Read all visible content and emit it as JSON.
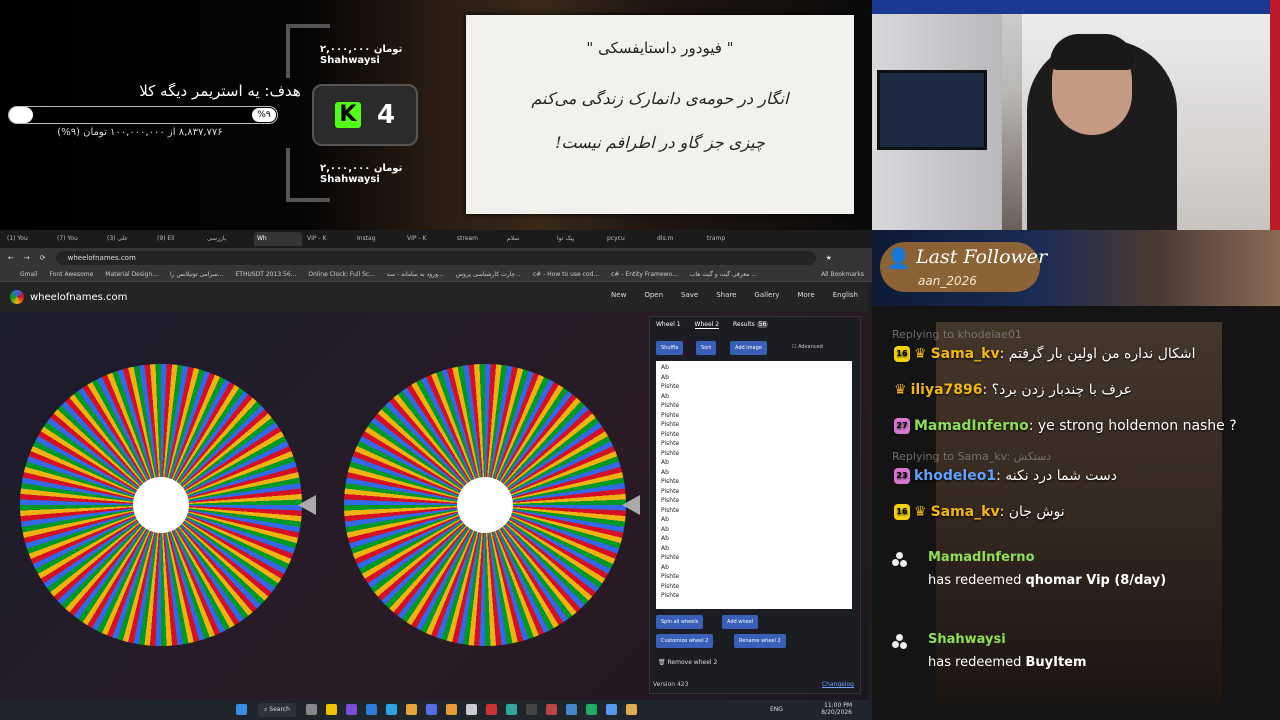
{
  "overlay": {
    "goal_title": "هدف: یه استریمر دیگه کلا",
    "goal_percent": "%۹",
    "goal_progress": 0.09,
    "goal_amount": "۸,۸۳۷,۷۷۶ از ۱۰۰,۰۰۰,۰۰۰ تومان (۹%)",
    "donation_top": {
      "user": "Shahwaysi",
      "amount": "۲,۰۰۰,۰۰۰ تومان"
    },
    "donation_bottom": {
      "user": "Shahwaysi",
      "amount": "۲,۰۰۰,۰۰۰ تومان"
    },
    "kick_logo": "K",
    "kick_count": "4",
    "quote": {
      "title": "\" فیودور داستایفسکی \"",
      "line1": "انگار در حومه‌ی دانمارک زندگی می‌کنم",
      "line2": "چیزی جز گاو در اطرافم نیست!"
    }
  },
  "browser": {
    "tabs": [
      "(1) You",
      "(7) You",
      "(3) علی",
      "(9) Eli",
      "بازرسی",
      "Wh",
      "VIP - K",
      "Instag",
      "VIP - K",
      "stream",
      "سلام",
      "پیک توا",
      "pcycu",
      "dls.m",
      "tramp"
    ],
    "active_tab_index": 5,
    "url": "wheelofnames.com",
    "bookmarks": [
      "Gmail",
      "Font Awesome",
      "Material Design...",
      "سرامی توتیلانس را...",
      "ETHUSDT 2013.56...",
      "Online Clock: Full Sc...",
      "ورود به سامانه - سه...",
      "چارت کارشناسی پروس...",
      "c# - How to use cod...",
      "c# - Entity Framewo...",
      "معرفی گیت و گیت هاب ..."
    ],
    "all_bookmarks": "All Bookmarks",
    "site_name": "wheelofnames.com",
    "site_menu": [
      "New",
      "Open",
      "Save",
      "Share",
      "Gallery",
      "More",
      "English"
    ],
    "panel": {
      "tab_wheel1": "Wheel 1",
      "tab_wheel2": "Wheel 2",
      "tab_results": "Results",
      "results_count": "56",
      "shuffle": "Shuffle",
      "sort": "Sort",
      "add_image": "Add image",
      "advanced": "Advanced",
      "entries": [
        "Ab",
        "Ab",
        "Pishte",
        "Ab",
        "Pishte",
        "Pishte",
        "Pishte",
        "Pishte",
        "Pishte",
        "Pishte",
        "Ab",
        "Ab",
        "Pishte",
        "Pishte",
        "Pishte",
        "Pishte",
        "Ab",
        "Ab",
        "Ab",
        "Ab",
        "Pishte",
        "Ab",
        "Pishte",
        "Pishte",
        "Pishte"
      ],
      "spin_all": "Spin all wheels",
      "add_wheel": "Add wheel",
      "customize": "Customize wheel 2",
      "rename": "Rename wheel 2",
      "remove": "Remove wheel 2",
      "version": "Version 423",
      "changelog": "Changelog"
    },
    "wheel_segments": 160,
    "wheel_colors": [
      "#3369e8",
      "#d50f25",
      "#eeb211",
      "#009925"
    ]
  },
  "taskbar": {
    "search": "Search",
    "lang": "ENG",
    "time": "11:00 PM",
    "date": "8/20/2026"
  },
  "follower": {
    "label": "Last Follower",
    "name": "aan_2026"
  },
  "chat": {
    "reply1": "Replying to khodelae01",
    "messages": [
      {
        "badge": "16",
        "user": "Sama_kv",
        "color": "#f3b712",
        "text": ": اشکال نداره من اولین بار گرفتم"
      },
      {
        "badge": "",
        "user": "iliya7896",
        "color": "#f3b712",
        "text": ": عرف با چندبار زدن برد؟"
      },
      {
        "badge": "27",
        "user": "MamadInferno",
        "color": "#8fdf5a",
        "text": ": ye strong holdemon nashe ?"
      }
    ],
    "reply2": "Replying to Sama_kv: دستکش",
    "messages2": [
      {
        "badge": "23",
        "user": "khodeleo1",
        "color": "#62a3ff",
        "text": ": دست شما درد نکنه"
      },
      {
        "badge": "16",
        "user": "Sama_kv",
        "color": "#f3b712",
        "text": ": نوش جان"
      }
    ],
    "redeems": [
      {
        "user": "MamadInferno",
        "action": "has redeemed",
        "item": "qhomar Vip (8/day)"
      },
      {
        "user": "Shahwaysi",
        "action": "has redeemed",
        "item": "BuyItem"
      }
    ]
  }
}
